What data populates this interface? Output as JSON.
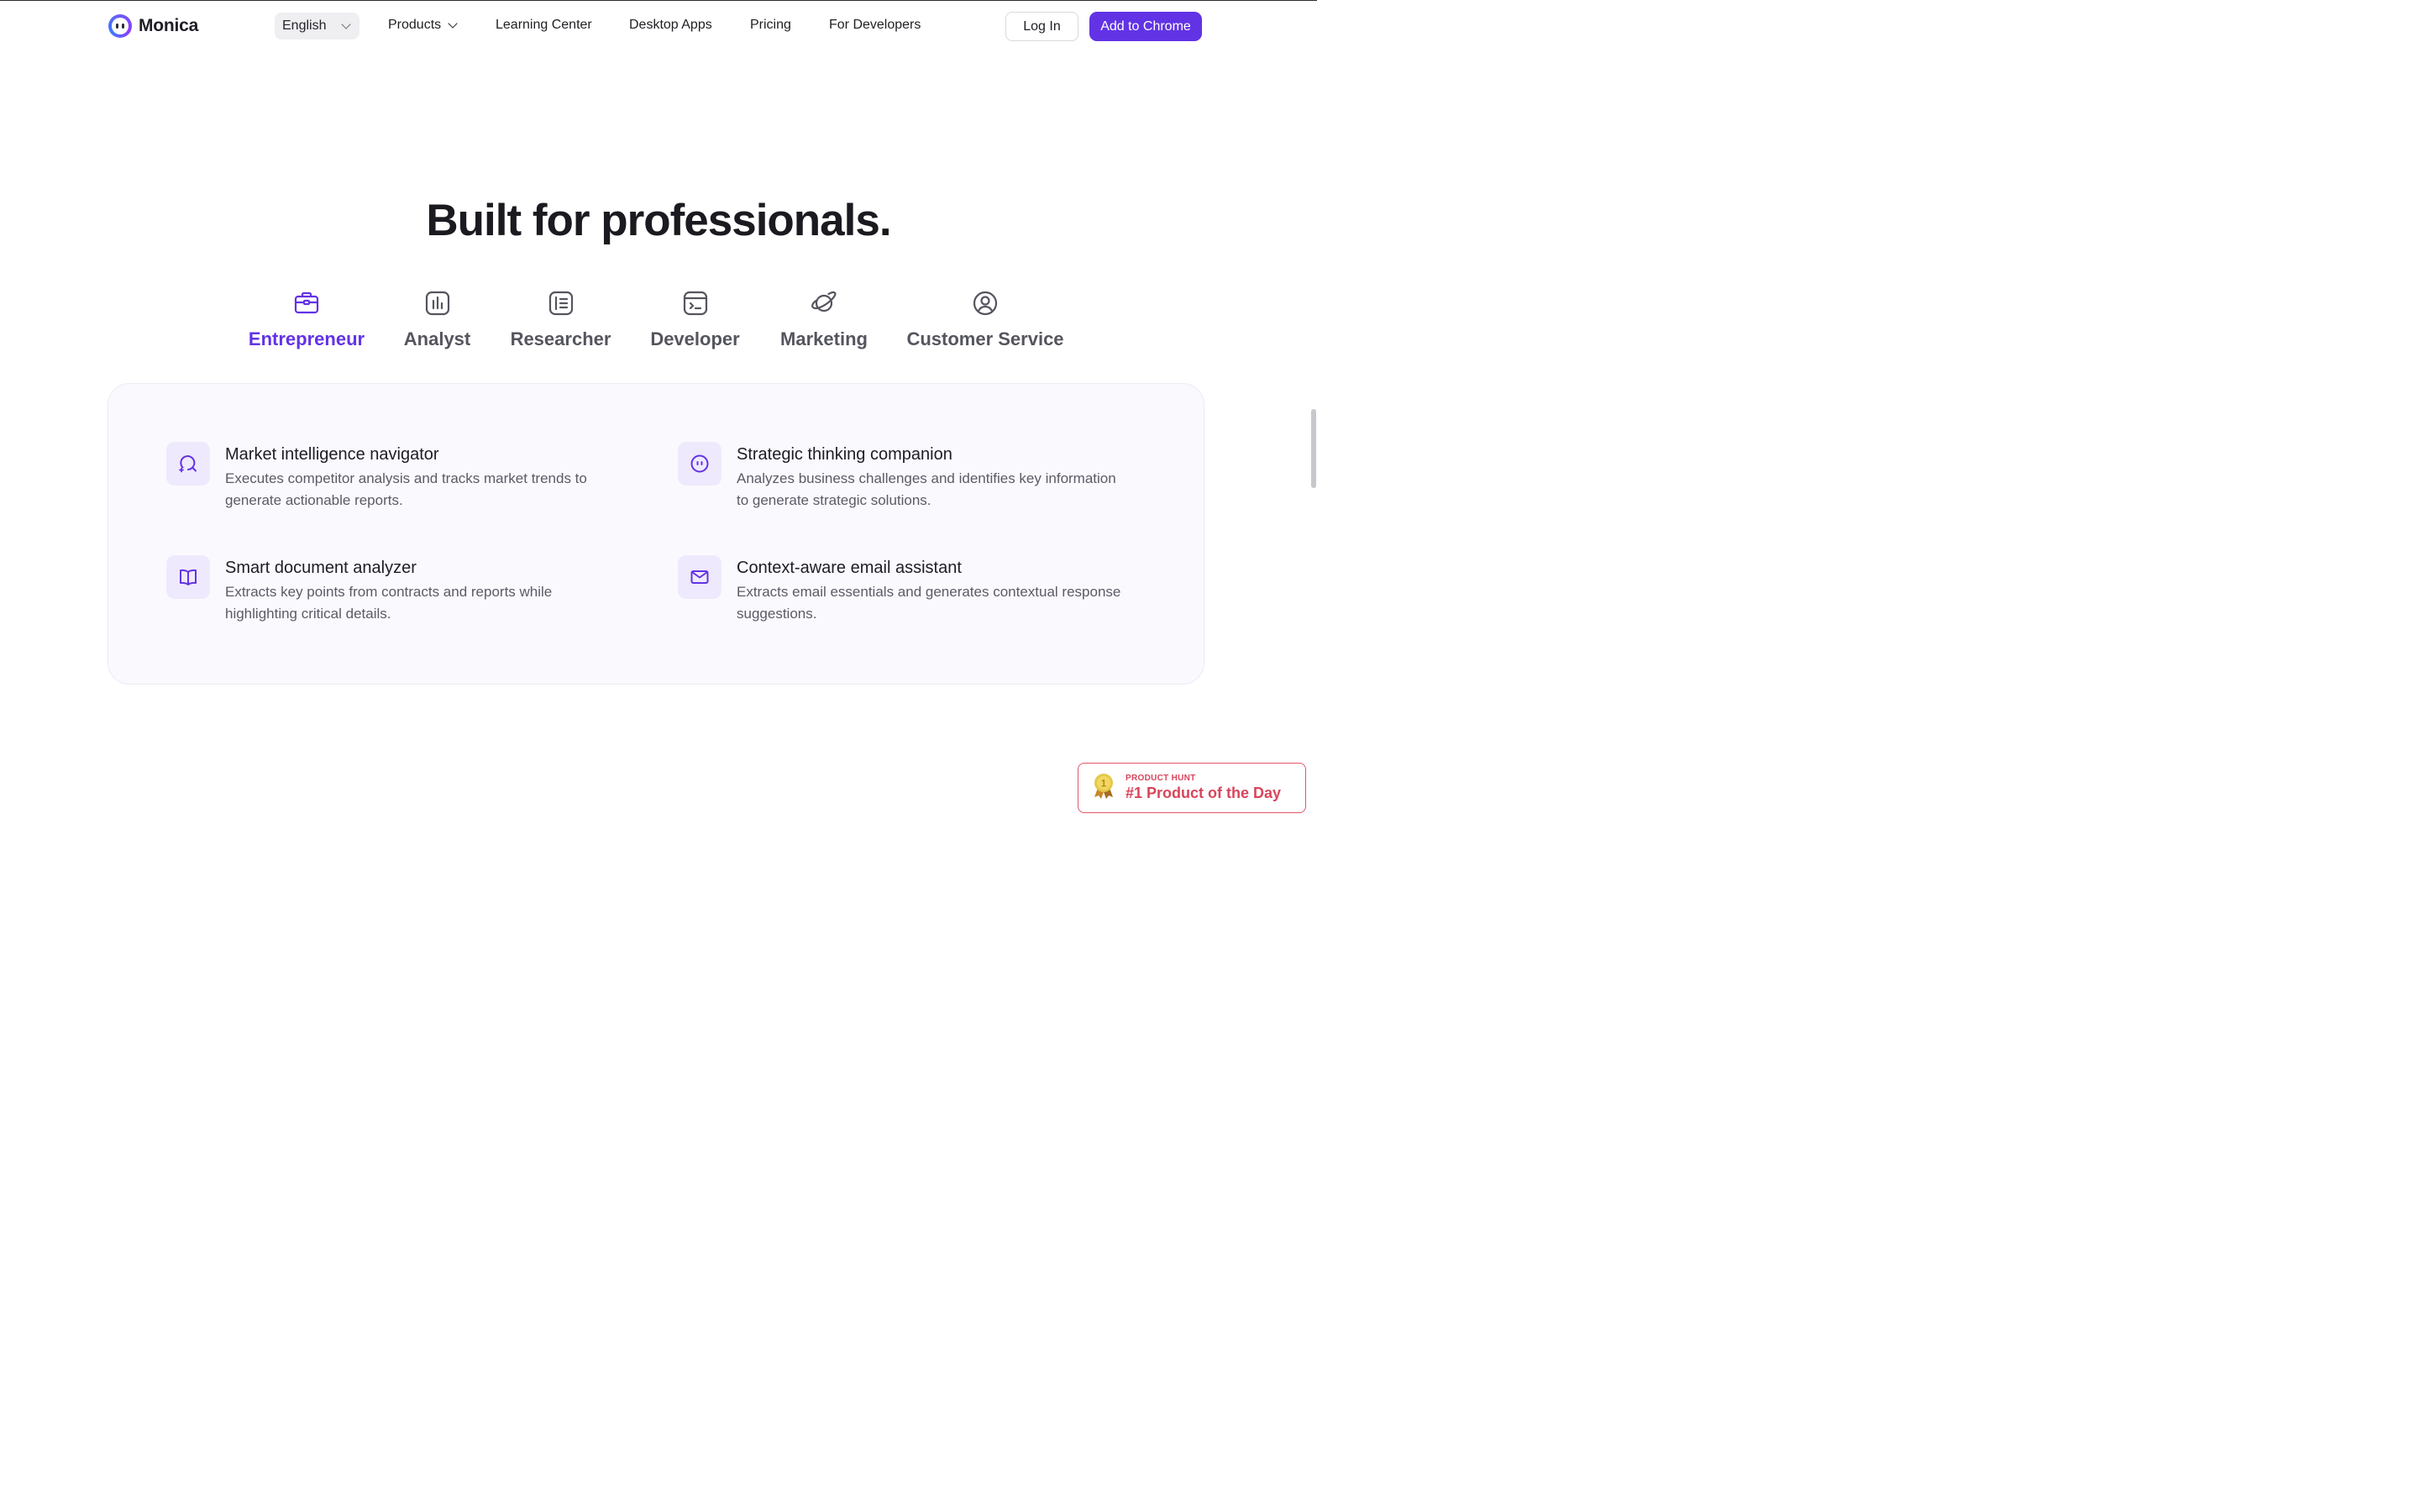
{
  "nav": {
    "logo_text": "Monica",
    "language": "English",
    "links": {
      "products": "Products",
      "learning": "Learning Center",
      "desktop": "Desktop Apps",
      "pricing": "Pricing",
      "developers": "For Developers"
    },
    "login": "Log In",
    "add_chrome": "Add to Chrome"
  },
  "headline": "Built for professionals.",
  "tabs": [
    {
      "label": "Entrepreneur",
      "icon": "briefcase-icon",
      "active": true
    },
    {
      "label": "Analyst",
      "icon": "bar-chart-icon"
    },
    {
      "label": "Researcher",
      "icon": "document-list-icon"
    },
    {
      "label": "Developer",
      "icon": "terminal-icon"
    },
    {
      "label": "Marketing",
      "icon": "planet-icon"
    },
    {
      "label": "Customer Service",
      "icon": "user-circle-icon"
    }
  ],
  "features": [
    {
      "title": "Market intelligence navigator",
      "desc1": "Executes competitor analysis and tracks market trends to",
      "desc2": "generate actionable reports.",
      "icon": "search-sparkle-icon"
    },
    {
      "title": "Strategic thinking companion",
      "desc1": "Analyzes business challenges and identifies key information",
      "desc2": "to generate strategic solutions.",
      "icon": "robot-face-icon"
    },
    {
      "title": "Smart document analyzer",
      "desc1": "Extracts key points from contracts and reports while",
      "desc2": "highlighting critical details.",
      "icon": "open-book-icon"
    },
    {
      "title": "Context-aware email assistant",
      "desc1": "Extracts email essentials and generates contextual response",
      "desc2": "suggestions.",
      "icon": "envelope-icon"
    }
  ],
  "product_hunt": {
    "label": "PRODUCT HUNT",
    "title": "#1 Product of the Day",
    "medal_number": "1"
  },
  "colors": {
    "accent": "#6233e5",
    "product_hunt": "#d8455b"
  }
}
